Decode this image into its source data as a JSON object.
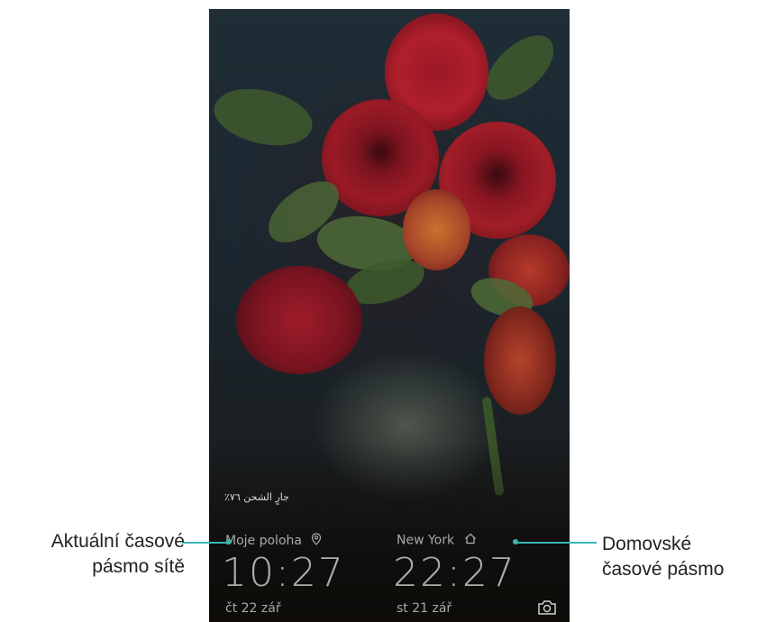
{
  "lockscreen": {
    "charging_text": "جارٍ الشحن ٧٦٪",
    "clock_local": {
      "city": "Moje poloha",
      "time": "10:27",
      "date": "čt 22 zář",
      "icon": "location-pin-icon"
    },
    "clock_home": {
      "city": "New York",
      "time": "22:27",
      "date": "st 21 zář",
      "icon": "home-icon"
    },
    "camera_icon": "camera-icon"
  },
  "callouts": {
    "left": {
      "line1": "Aktuální časové",
      "line2": "pásmo sítě"
    },
    "right": {
      "line1": "Domovské",
      "line2": "časové pásmo"
    }
  },
  "colors": {
    "callout_line": "#3ab6b5"
  }
}
